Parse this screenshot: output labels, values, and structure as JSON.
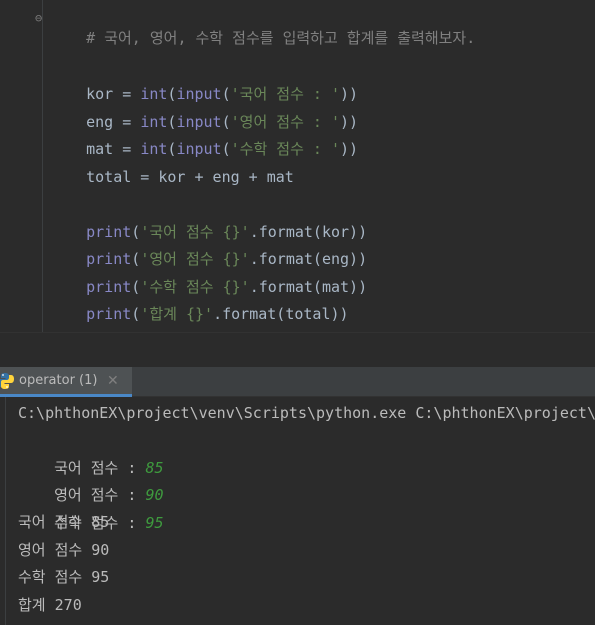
{
  "editor": {
    "comment_line": "# 국어, 영어, 수학 점수를 입력하고 합계를 출력해보자.",
    "lines": [
      {
        "var": "kor",
        "eq": " = ",
        "fn1": "int",
        "p1": "(",
        "fn2": "input",
        "p2": "(",
        "str": "'국어 점수 : '",
        "tail": "))"
      },
      {
        "var": "eng",
        "eq": " = ",
        "fn1": "int",
        "p1": "(",
        "fn2": "input",
        "p2": "(",
        "str": "'영어 점수 : '",
        "tail": "))"
      },
      {
        "var": "mat",
        "eq": " = ",
        "fn1": "int",
        "p1": "(",
        "fn2": "input",
        "p2": "(",
        "str": "'수학 점수 : '",
        "tail": "))"
      }
    ],
    "total_line": "total = kor + eng + mat",
    "prints": [
      {
        "fn": "print",
        "open": "(",
        "str": "'국어 점수 {}'",
        "tail": ".format(kor))"
      },
      {
        "fn": "print",
        "open": "(",
        "str": "'영어 점수 {}'",
        "tail": ".format(eng))"
      },
      {
        "fn": "print",
        "open": "(",
        "str": "'수학 점수 {}'",
        "tail": ".format(mat))"
      },
      {
        "fn": "print",
        "open": "(",
        "str": "'합계 {}'",
        "tail": ".format(total))"
      }
    ]
  },
  "run_panel": {
    "tab_label": "operator (1)",
    "close_glyph": "✕"
  },
  "console": {
    "command": "C:\\phthonEX\\project\\venv\\Scripts\\python.exe C:\\phthonEX\\project\\operator.py",
    "prompts": [
      {
        "prompt": "국어 점수 : ",
        "value": "85"
      },
      {
        "prompt": "영어 점수 : ",
        "value": "90"
      },
      {
        "prompt": "수학 점수 : ",
        "value": "95"
      }
    ],
    "outputs": [
      "국어 점수 85",
      "영어 점수 90",
      "수학 점수 95",
      "합계 270"
    ]
  },
  "colors": {
    "editor_bg": "#2b2b2b",
    "comment": "#808080",
    "builtin": "#8888c6",
    "string": "#6a8759",
    "input_echo": "#3e9a3e",
    "tab_accent": "#4a88c7"
  }
}
